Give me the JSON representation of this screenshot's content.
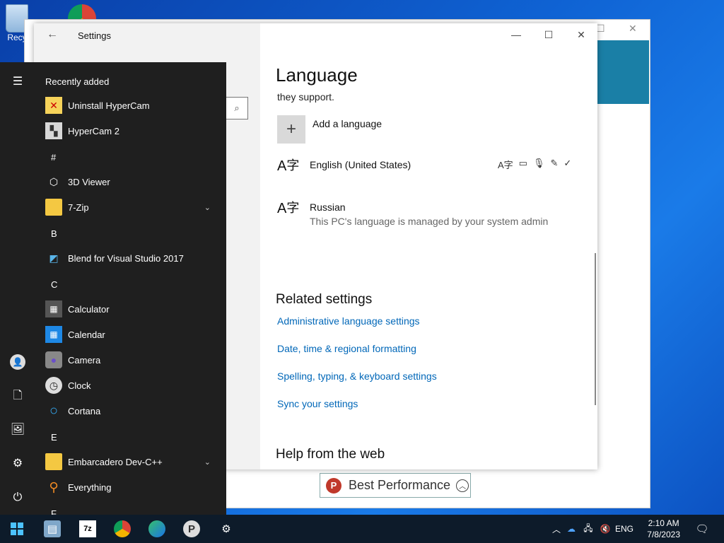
{
  "desktop": {
    "recycle_label": "Recy"
  },
  "back_window": {
    "badge_text": "Best Performance"
  },
  "settings": {
    "window_title": "Settings",
    "page_title": "Language",
    "support_text": "they support.",
    "add_language": "Add a language",
    "languages": [
      {
        "name": "English (United States)",
        "sub": ""
      },
      {
        "name": "Russian",
        "sub": "This PC's language is managed by your system admin"
      }
    ],
    "related_heading": "Related settings",
    "links": [
      "Administrative language settings",
      "Date, time & regional formatting",
      "Spelling, typing, & keyboard settings",
      "Sync your settings"
    ],
    "help_heading": "Help from the web"
  },
  "start_menu": {
    "recently_added": "Recently added",
    "items": [
      {
        "label": "Uninstall HyperCam",
        "icon": "hypercam-uninstall-icon"
      },
      {
        "label": "HyperCam 2",
        "icon": "hypercam-icon"
      },
      {
        "letter": "#"
      },
      {
        "label": "3D Viewer",
        "icon": "cube-icon"
      },
      {
        "label": "7-Zip",
        "icon": "folder-icon",
        "expand": true
      },
      {
        "letter": "B"
      },
      {
        "label": "Blend for Visual Studio 2017",
        "icon": "blend-icon"
      },
      {
        "letter": "C"
      },
      {
        "label": "Calculator",
        "icon": "calculator-icon"
      },
      {
        "label": "Calendar",
        "icon": "calendar-icon"
      },
      {
        "label": "Camera",
        "icon": "camera-icon"
      },
      {
        "label": "Clock",
        "icon": "clock-icon"
      },
      {
        "label": "Cortana",
        "icon": "cortana-icon"
      },
      {
        "letter": "E"
      },
      {
        "label": "Embarcadero Dev-C++",
        "icon": "folder-icon",
        "expand": true
      },
      {
        "label": "Everything",
        "icon": "magnifier-icon"
      },
      {
        "letter": "F"
      }
    ]
  },
  "taskbar": {
    "language": "ENG",
    "time": "2:10 AM",
    "date": "7/8/2023"
  }
}
